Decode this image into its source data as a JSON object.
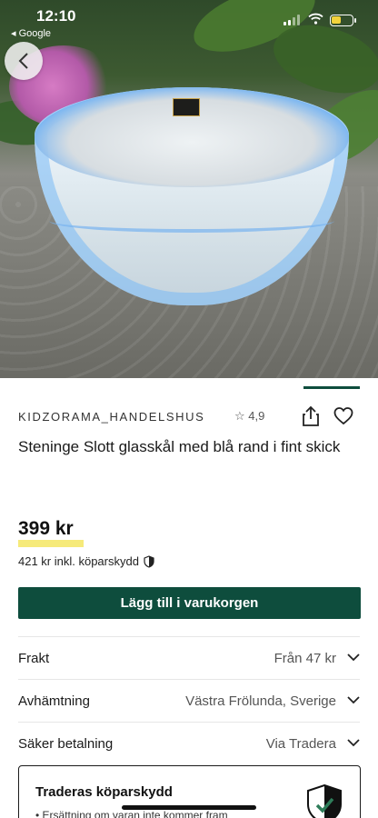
{
  "status_bar": {
    "time": "12:10",
    "back_app": "◂ Google"
  },
  "hero": {
    "image_description_icon": "product-photo"
  },
  "seller": {
    "name": "KIDZORAMA_HANDELSHUS",
    "rating": "☆ 4,9"
  },
  "product": {
    "title": "Steninge Slott glasskål med blå rand i fint skick",
    "price": "399 kr",
    "protected_price": "421 kr inkl. köparskydd"
  },
  "actions": {
    "add_to_cart": "Lägg till i varukorgen"
  },
  "details": [
    {
      "label": "Frakt",
      "value": "Från 47 kr"
    },
    {
      "label": "Avhämtning",
      "value": "Västra Frölunda, Sverige"
    },
    {
      "label": "Säker betalning",
      "value": "Via Tradera"
    }
  ],
  "protection": {
    "title": "Traderas köparskydd",
    "item": "• Ersättning om varan inte kommer fram"
  },
  "colors": {
    "brand_green": "#0e4d3d",
    "price_highlight": "#f6ea7a"
  }
}
